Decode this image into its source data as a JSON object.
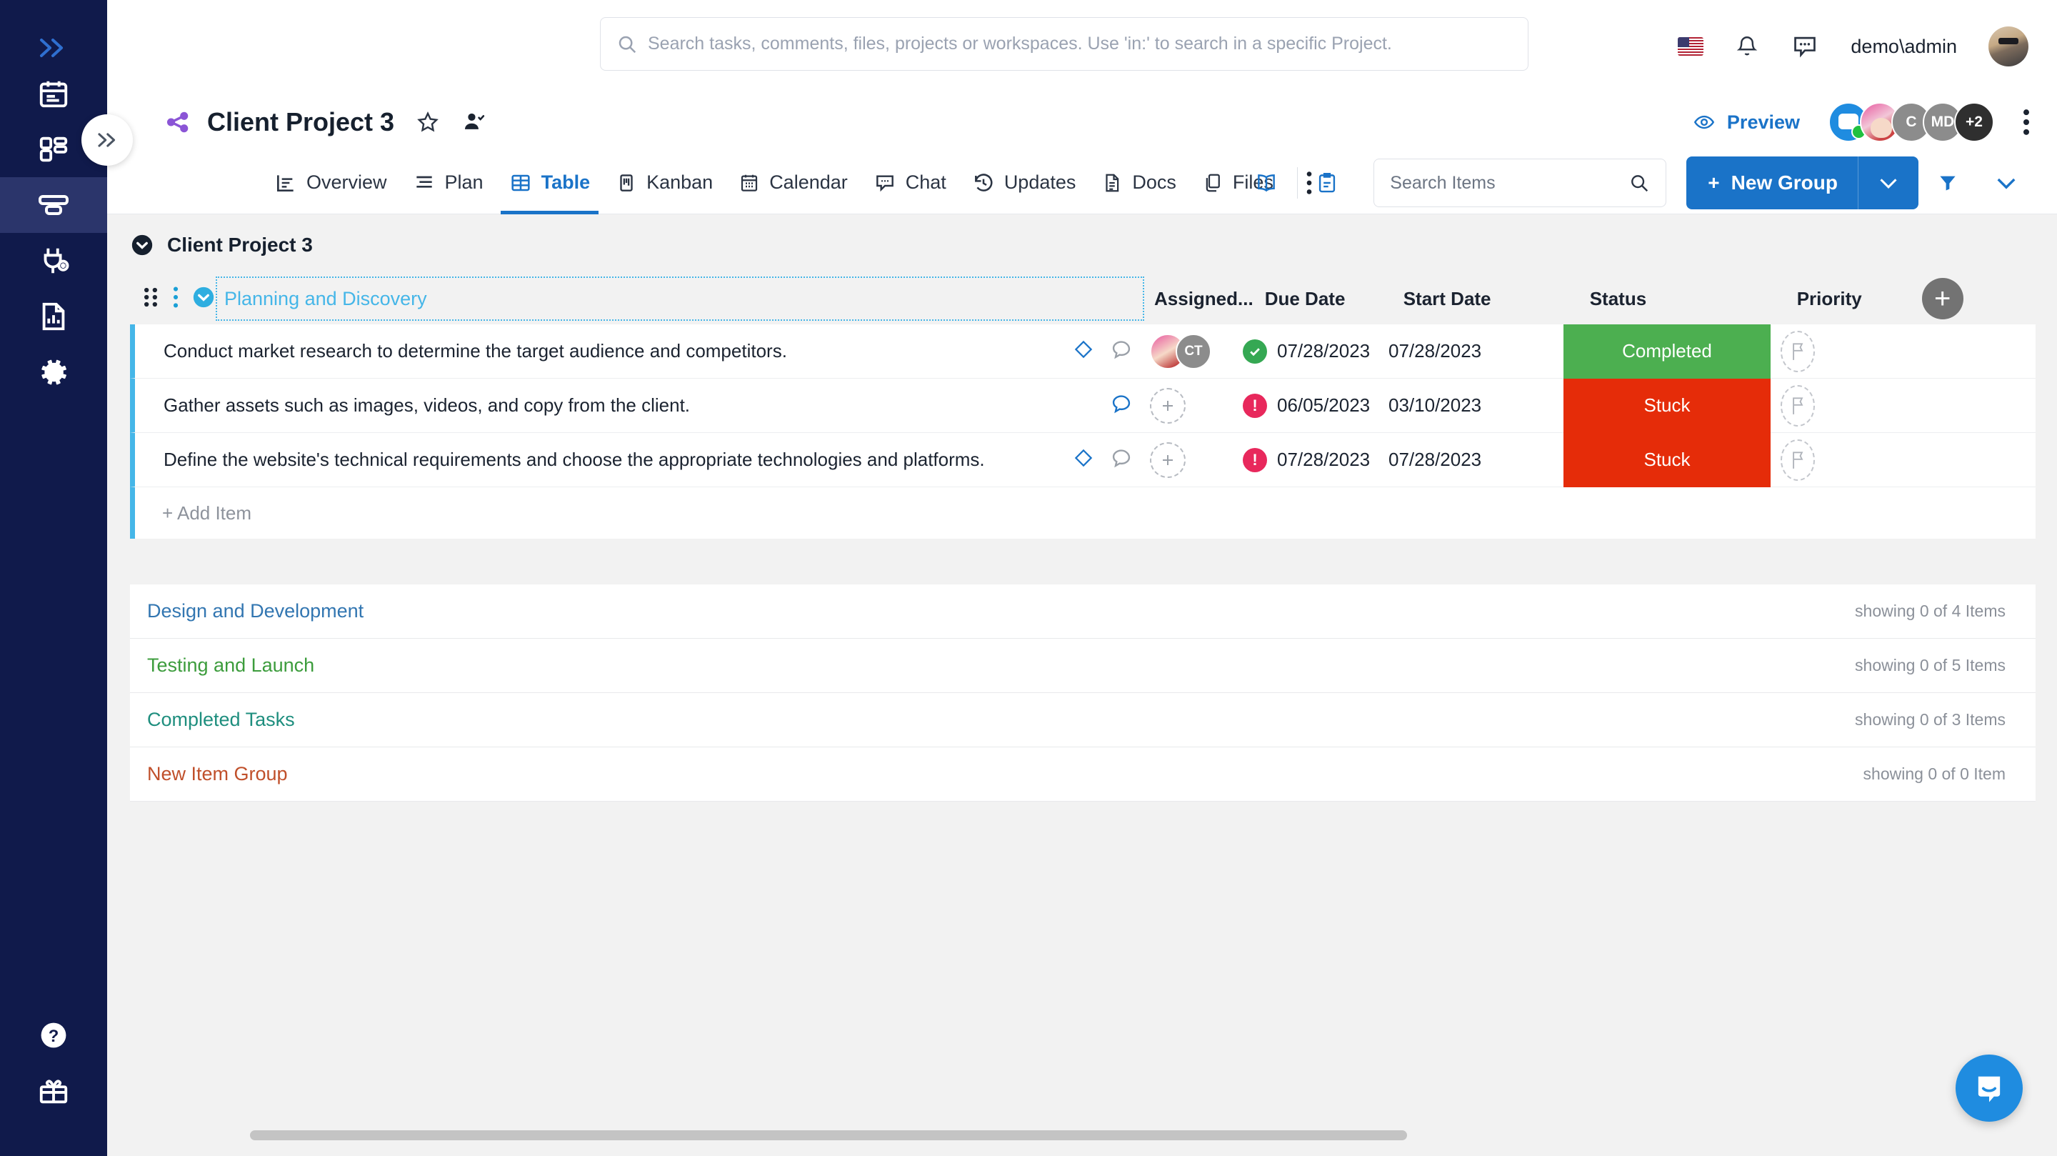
{
  "sidebar": {
    "expand_icon": "chevron-double-right-icon",
    "items": [
      {
        "icon": "calendar-icon",
        "label": "Calendar",
        "active": false
      },
      {
        "icon": "dashboard-icon",
        "label": "Dashboard",
        "active": false
      },
      {
        "icon": "projects-icon",
        "label": "Projects",
        "active": true
      },
      {
        "icon": "integrations-icon",
        "label": "Integrations",
        "active": false
      },
      {
        "icon": "reports-icon",
        "label": "Reports",
        "active": false
      },
      {
        "icon": "settings-icon",
        "label": "Settings",
        "active": false
      }
    ],
    "bottom_items": [
      {
        "icon": "help-icon",
        "label": "Help"
      },
      {
        "icon": "gift-icon",
        "label": "What's New"
      }
    ]
  },
  "topbar": {
    "search": {
      "icon": "search-icon",
      "placeholder": "Search tasks, comments, files, projects or workspaces. Use 'in:' to search in a specific Project.",
      "value": ""
    },
    "flag_icon": "us-flag-icon",
    "bell_icon": "bell-icon",
    "messages_icon": "message-dots-icon",
    "username": "demo\\admin",
    "avatar_icon": "user-avatar"
  },
  "project_header": {
    "share_icon": "share-nodes-icon",
    "title": "Client Project 3",
    "favorite_icon": "star-outline-icon",
    "add_member_icon": "user-check-icon",
    "preview_label": "Preview",
    "preview_icon": "eye-icon",
    "members": [
      {
        "type": "bot",
        "label": "",
        "online": true
      },
      {
        "type": "photo",
        "label": ""
      },
      {
        "type": "grey",
        "label": "C"
      },
      {
        "type": "grey",
        "label": "MD"
      },
      {
        "type": "dark",
        "label": "+2"
      }
    ],
    "kebab_icon": "more-vertical-icon"
  },
  "tabs": [
    {
      "label": "Overview",
      "icon": "overview-icon",
      "active": false
    },
    {
      "label": "Plan",
      "icon": "plan-icon",
      "active": false
    },
    {
      "label": "Table",
      "icon": "table-icon",
      "active": true
    },
    {
      "label": "Kanban",
      "icon": "kanban-icon",
      "active": false
    },
    {
      "label": "Calendar",
      "icon": "calendar-icon",
      "active": false
    },
    {
      "label": "Chat",
      "icon": "chat-icon",
      "active": false
    },
    {
      "label": "Updates",
      "icon": "history-icon",
      "active": false
    },
    {
      "label": "Docs",
      "icon": "doc-icon",
      "active": false
    },
    {
      "label": "Files",
      "icon": "files-icon",
      "active": false
    }
  ],
  "toolbar": {
    "overflow_icon": "more-vertical-icon",
    "book_icon": "book-icon",
    "clipboard_icon": "clipboard-icon",
    "item_search_placeholder": "Search Items",
    "item_search_value": "",
    "item_search_icon": "search-icon",
    "new_group_label": "New Group",
    "new_group_plus": "+",
    "new_group_caret_icon": "chevron-down-icon",
    "filter_icon": "filter-funnel-icon",
    "collapse_icon": "chevron-down-icon"
  },
  "board": {
    "board_title": "Client Project 3",
    "board_chevron_icon": "chevron-down-circle-icon",
    "group": {
      "name": "Planning and Discovery",
      "drag_icon": "drag-handle-icon",
      "menu_icon": "more-vertical-icon",
      "collapse_icon": "chevron-down-circle-icon",
      "accent": "#45b6e8"
    },
    "columns": [
      "Assigned...",
      "Due Date",
      "Start Date",
      "Status",
      "Priority"
    ],
    "add_column_icon": "plus-icon",
    "rows": [
      {
        "task": "Conduct market research to determine the target audience and competitors.",
        "diamond": true,
        "diamond_color": "#1a73c8",
        "comment_color": "#9aa0a8",
        "assignees": [
          {
            "type": "photo",
            "label": ""
          },
          {
            "type": "initials",
            "label": "CT"
          }
        ],
        "due_date": "07/28/2023",
        "due_state": "done",
        "due_icon": "check-circle-icon",
        "start_date": "07/28/2023",
        "status": "Completed",
        "status_color": "#4CAF50",
        "priority_icon": "flag-outline-icon"
      },
      {
        "task": "Gather assets such as images, videos, and copy from the client.",
        "diamond": false,
        "diamond_color": "",
        "comment_color": "#1a73c8",
        "assignees": [],
        "due_date": "06/05/2023",
        "due_state": "overdue",
        "due_icon": "alert-circle-icon",
        "start_date": "03/10/2023",
        "status": "Stuck",
        "status_color": "#E52C09",
        "priority_icon": "flag-outline-icon"
      },
      {
        "task": "Define the website's technical requirements and choose the appropriate technologies and platforms.",
        "diamond": true,
        "diamond_color": "#1a73c8",
        "comment_color": "#9aa0a8",
        "assignees": [],
        "due_date": "07/28/2023",
        "due_state": "overdue",
        "due_icon": "alert-circle-icon",
        "start_date": "07/28/2023",
        "status": "Stuck",
        "status_color": "#E52C09",
        "priority_icon": "flag-outline-icon"
      }
    ],
    "add_item_label": "+ Add Item",
    "collapsed_groups": [
      {
        "name": "Design and Development",
        "color": "#3276b1",
        "count": "showing 0 of 4 Items"
      },
      {
        "name": "Testing and Launch",
        "color": "#3c9c3c",
        "count": "showing 0 of 5 Items"
      },
      {
        "name": "Completed Tasks",
        "color": "#1e8e7e",
        "count": "showing 0 of 3 Items"
      },
      {
        "name": "New Item Group",
        "color": "#c0502b",
        "count": "showing 0 of 0 Item"
      }
    ]
  },
  "footer": {
    "scrollbar": "horizontal-scrollbar",
    "intercom_icon": "intercom-chat-icon"
  }
}
